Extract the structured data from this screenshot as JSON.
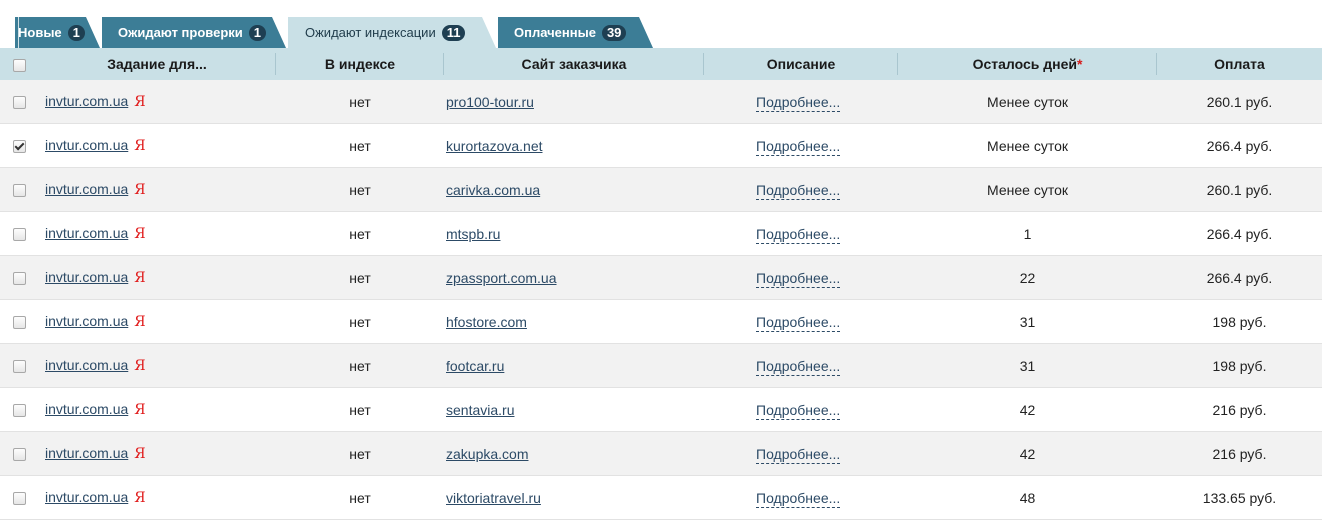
{
  "tabs": [
    {
      "label": "Новые",
      "count": "1",
      "active": false
    },
    {
      "label": "Ожидают проверки",
      "count": "1",
      "active": false
    },
    {
      "label": "Ожидают индексации",
      "count": "11",
      "active": true
    },
    {
      "label": "Оплаченные",
      "count": "39",
      "active": false
    }
  ],
  "table": {
    "columns": {
      "task": "Задание для...",
      "in_index": "В индексе",
      "client_site": "Сайт заказчика",
      "description": "Описание",
      "days_left": "Осталось дней",
      "days_left_mark": "*",
      "payment": "Оплата"
    },
    "rows": [
      {
        "checked": false,
        "task": "invtur.com.ua",
        "engine": "Я",
        "in_index": "нет",
        "site": "pro100-tour.ru",
        "desc": "Подробнее...",
        "days": "Менее суток",
        "pay": "260.1 руб."
      },
      {
        "checked": true,
        "task": "invtur.com.ua",
        "engine": "Я",
        "in_index": "нет",
        "site": "kurortazova.net",
        "desc": "Подробнее...",
        "days": "Менее суток",
        "pay": "266.4 руб."
      },
      {
        "checked": false,
        "task": "invtur.com.ua",
        "engine": "Я",
        "in_index": "нет",
        "site": "carivka.com.ua",
        "desc": "Подробнее...",
        "days": "Менее суток",
        "pay": "260.1 руб."
      },
      {
        "checked": false,
        "task": "invtur.com.ua",
        "engine": "Я",
        "in_index": "нет",
        "site": "mtspb.ru",
        "desc": "Подробнее...",
        "days": "1",
        "pay": "266.4 руб."
      },
      {
        "checked": false,
        "task": "invtur.com.ua",
        "engine": "Я",
        "in_index": "нет",
        "site": "zpassport.com.ua",
        "desc": "Подробнее...",
        "days": "22",
        "pay": "266.4 руб."
      },
      {
        "checked": false,
        "task": "invtur.com.ua",
        "engine": "Я",
        "in_index": "нет",
        "site": "hfostore.com",
        "desc": "Подробнее...",
        "days": "31",
        "pay": "198 руб."
      },
      {
        "checked": false,
        "task": "invtur.com.ua",
        "engine": "Я",
        "in_index": "нет",
        "site": "footcar.ru",
        "desc": "Подробнее...",
        "days": "31",
        "pay": "198 руб."
      },
      {
        "checked": false,
        "task": "invtur.com.ua",
        "engine": "Я",
        "in_index": "нет",
        "site": "sentavia.ru",
        "desc": "Подробнее...",
        "days": "42",
        "pay": "216 руб."
      },
      {
        "checked": false,
        "task": "invtur.com.ua",
        "engine": "Я",
        "in_index": "нет",
        "site": "zakupka.com",
        "desc": "Подробнее...",
        "days": "42",
        "pay": "216 руб."
      },
      {
        "checked": false,
        "task": "invtur.com.ua",
        "engine": "Я",
        "in_index": "нет",
        "site": "viktoriatravel.ru",
        "desc": "Подробнее...",
        "days": "48",
        "pay": "133.65 руб."
      }
    ]
  }
}
